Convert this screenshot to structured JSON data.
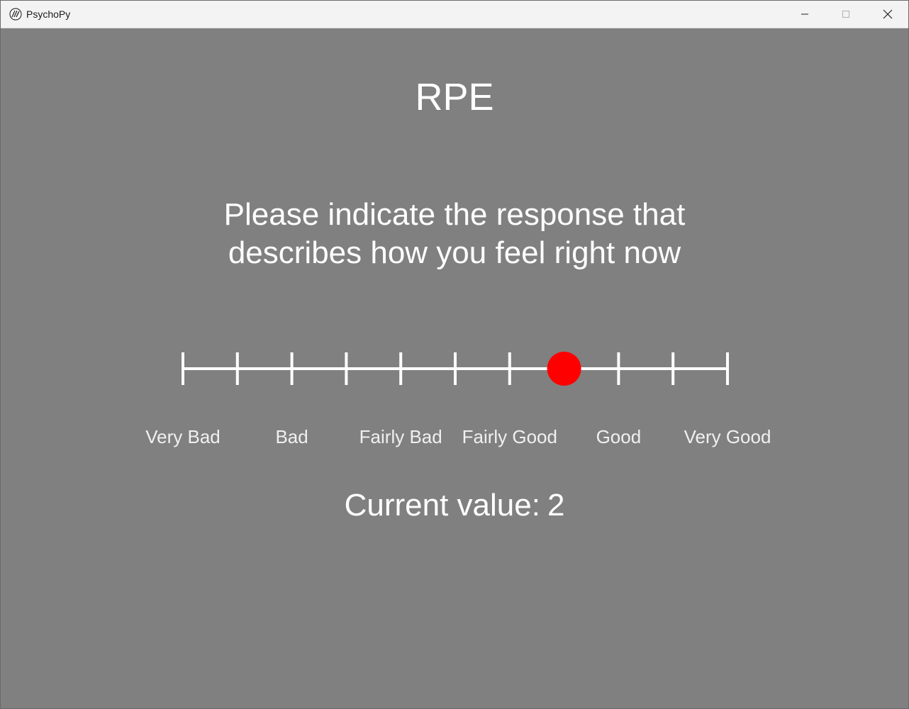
{
  "window": {
    "title": "PsychoPy",
    "icon": "psychopy-logo-icon",
    "controls": [
      "minimize-icon",
      "maximize-icon",
      "close-icon"
    ]
  },
  "screen": {
    "background": "#808080",
    "heading": "RPE",
    "instruction_line1": "Please indicate the response that",
    "instruction_line2": "describes how you feel right now"
  },
  "slider": {
    "tick_count": 11,
    "selected_index": 7,
    "marker_color": "#ff0000",
    "line_color": "#ffffff",
    "labels": [
      {
        "text": "Very Bad",
        "tick": 0
      },
      {
        "text": "Bad",
        "tick": 2
      },
      {
        "text": "Fairly Bad",
        "tick": 4
      },
      {
        "text": "Fairly Good",
        "tick": 6
      },
      {
        "text": "Good",
        "tick": 8
      },
      {
        "text": "Very Good",
        "tick": 10
      }
    ]
  },
  "status": {
    "label": "Current value:",
    "value": "2"
  }
}
